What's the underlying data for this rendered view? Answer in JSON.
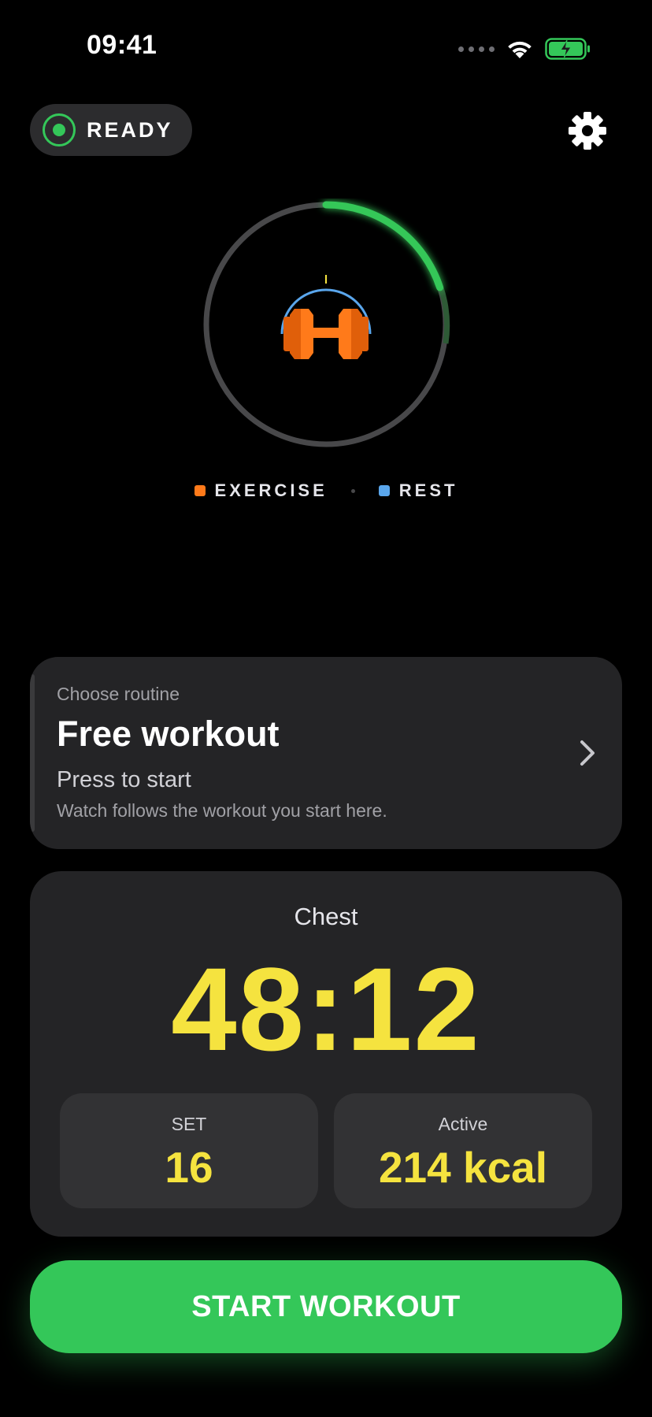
{
  "status_bar": {
    "time": "09:41"
  },
  "header": {
    "status_label": "READY",
    "settings_icon": "gear-icon"
  },
  "ring": {
    "progress": 0.2,
    "center_icon": "dumbbell-icon",
    "colors": {
      "progress": "#34c759",
      "track": "#48484a",
      "exercise": "#ff7a1a",
      "rest": "#5aa6ec"
    }
  },
  "legend": {
    "exercise": "EXERCISE",
    "rest": "REST"
  },
  "routine": {
    "overline": "Choose routine",
    "title": "Free workout",
    "subtitle": "Press to start",
    "note": "Watch follows the workout you start here."
  },
  "stats": {
    "workout_name": "Chest",
    "timer": "48:12",
    "set_label": "SET",
    "set_value": "16",
    "active_label": "Active",
    "active_value": "214 kcal"
  },
  "cta": {
    "start_label": "START WORKOUT"
  },
  "colors": {
    "accent_green": "#34c759",
    "accent_yellow": "#f5e33f",
    "card_bg": "#242426"
  }
}
